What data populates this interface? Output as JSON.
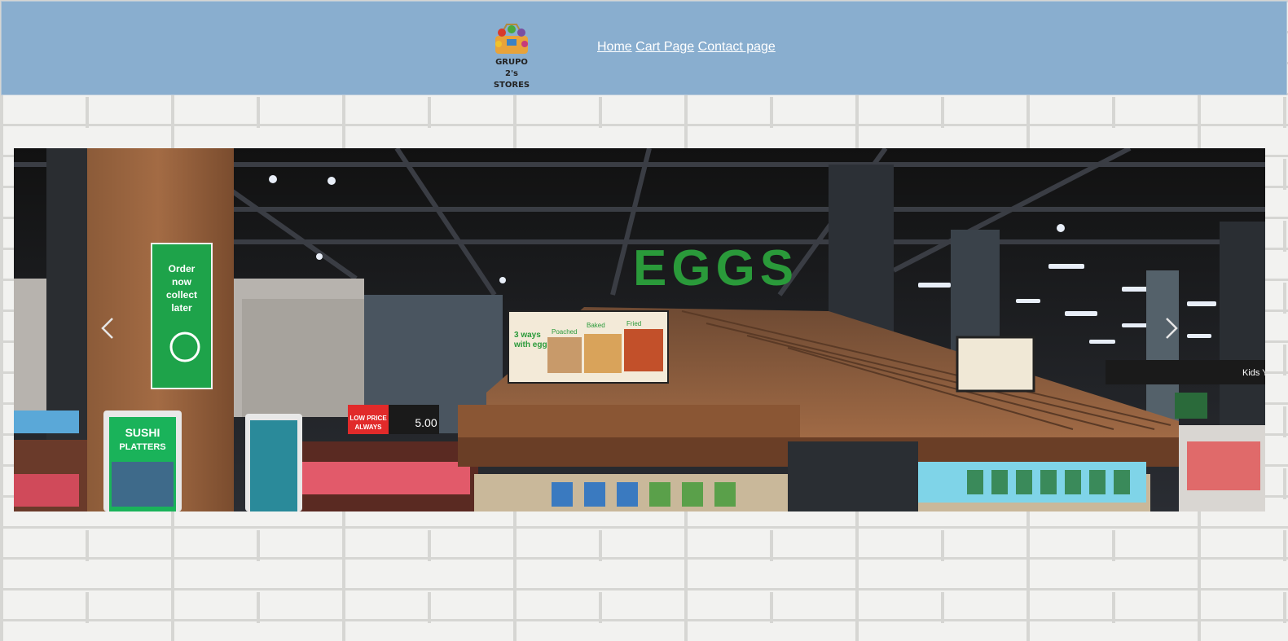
{
  "header": {
    "logo_text": "GRUPO 2's\nSTORES",
    "nav": [
      {
        "label": "Home"
      },
      {
        "label": "Cart Page"
      },
      {
        "label": "Contact page"
      }
    ]
  },
  "carousel": {
    "signage": {
      "eggs": "EGGS",
      "order_sign": "Order now collect later",
      "sushi": "SUSHI PLATTERS",
      "low_price": "LOW PRICE ALWAYS",
      "rashers_price": "5.00",
      "ways_with_eggs": "3 ways with eggs",
      "poached": "Poached",
      "baked": "Baked",
      "fried": "Fried",
      "kids": "Kids Y"
    }
  },
  "colors": {
    "header_bg": "#89aecf",
    "nav_link": "#ffffff",
    "brick": "#f2f2f0"
  }
}
